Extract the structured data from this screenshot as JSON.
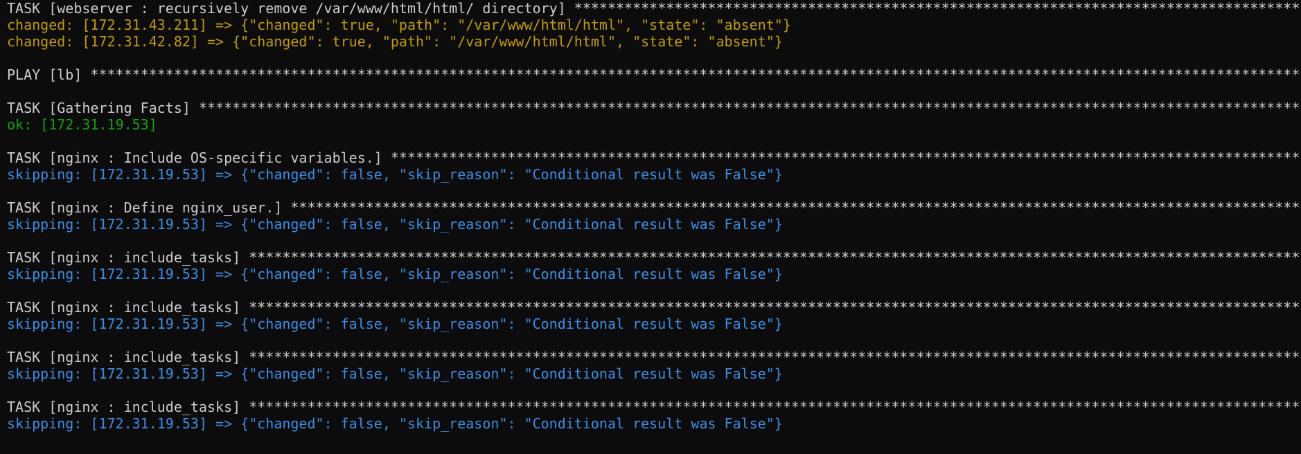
{
  "terminal": {
    "colors": {
      "background": "#0c0c0c",
      "default": "#cccccc",
      "changed": "#c19c00",
      "ok": "#13a10e",
      "skipping": "#3b8eea"
    },
    "lines": [
      {
        "text": "TASK [webserver : recursively remove /var/www/html/html/ directory] ******************************************************************************************",
        "kind": "default"
      },
      {
        "text": "changed: [172.31.43.211] => {\"changed\": true, \"path\": \"/var/www/html/html\", \"state\": \"absent\"}",
        "kind": "changed"
      },
      {
        "text": "changed: [172.31.42.82] => {\"changed\": true, \"path\": \"/var/www/html/html\", \"state\": \"absent\"}",
        "kind": "changed"
      },
      {
        "text": "",
        "kind": "blank"
      },
      {
        "text": "PLAY [lb] ***********************************************************************************************************************************************************",
        "kind": "default"
      },
      {
        "text": "",
        "kind": "blank"
      },
      {
        "text": "TASK [Gathering Facts] **********************************************************************************************************************************************",
        "kind": "default"
      },
      {
        "text": "ok: [172.31.19.53]",
        "kind": "ok"
      },
      {
        "text": "",
        "kind": "blank"
      },
      {
        "text": "TASK [nginx : Include OS-specific variables.] *******************************************************************************************************************",
        "kind": "default"
      },
      {
        "text": "skipping: [172.31.19.53] => {\"changed\": false, \"skip_reason\": \"Conditional result was False\"}",
        "kind": "skipping"
      },
      {
        "text": "",
        "kind": "blank"
      },
      {
        "text": "TASK [nginx : Define nginx_user.] ******************************************************************************************************************************",
        "kind": "default"
      },
      {
        "text": "skipping: [172.31.19.53] => {\"changed\": false, \"skip_reason\": \"Conditional result was False\"}",
        "kind": "skipping"
      },
      {
        "text": "",
        "kind": "blank"
      },
      {
        "text": "TASK [nginx : include_tasks] ***********************************************************************************************************************************",
        "kind": "default"
      },
      {
        "text": "skipping: [172.31.19.53] => {\"changed\": false, \"skip_reason\": \"Conditional result was False\"}",
        "kind": "skipping"
      },
      {
        "text": "",
        "kind": "blank"
      },
      {
        "text": "TASK [nginx : include_tasks] ***********************************************************************************************************************************",
        "kind": "default"
      },
      {
        "text": "skipping: [172.31.19.53] => {\"changed\": false, \"skip_reason\": \"Conditional result was False\"}",
        "kind": "skipping"
      },
      {
        "text": "",
        "kind": "blank"
      },
      {
        "text": "TASK [nginx : include_tasks] ***********************************************************************************************************************************",
        "kind": "default"
      },
      {
        "text": "skipping: [172.31.19.53] => {\"changed\": false, \"skip_reason\": \"Conditional result was False\"}",
        "kind": "skipping"
      },
      {
        "text": "",
        "kind": "blank"
      },
      {
        "text": "TASK [nginx : include_tasks] ***********************************************************************************************************************************",
        "kind": "default"
      },
      {
        "text": "skipping: [172.31.19.53] => {\"changed\": false, \"skip_reason\": \"Conditional result was False\"}",
        "kind": "skipping"
      }
    ]
  }
}
